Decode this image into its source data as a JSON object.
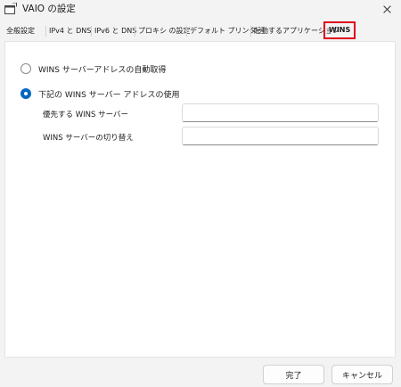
{
  "window": {
    "title": "VAIO の設定",
    "icon": "app-window-icon",
    "close_icon": "close-icon"
  },
  "tabs": [
    {
      "label": "全般設定",
      "active": false
    },
    {
      "label": "IPv4 と DNS",
      "active": false
    },
    {
      "label": "IPv6 と DNS",
      "active": false
    },
    {
      "label": "プロキシ の設定",
      "active": false
    },
    {
      "label": "デフォルト プリンター",
      "active": false
    },
    {
      "label": "起動するアプリケーション",
      "active": false
    },
    {
      "label": "WINS",
      "active": true
    }
  ],
  "wins": {
    "auto_option": {
      "label": "WINS サーバーアドレスの自動取得",
      "checked": false
    },
    "manual_option": {
      "label": "下記の WINS サーバー アドレスの使用",
      "checked": true
    },
    "preferred_label": "優先する WINS サーバー",
    "preferred_value": "",
    "alternate_label": "WINS サーバーの切り替え",
    "alternate_value": ""
  },
  "buttons": {
    "ok_label": "完了",
    "cancel_label": "キャンセル"
  },
  "colors": {
    "accent": "#0067c0",
    "highlight_border": "#e0001b"
  }
}
